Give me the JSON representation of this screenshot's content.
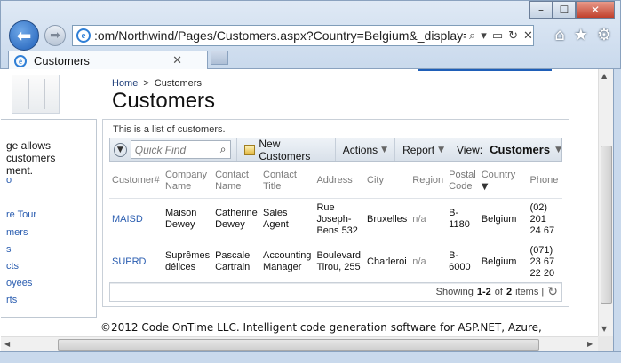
{
  "browser": {
    "address": ":om/Northwind/Pages/Customers.aspx?Country=Belgium&_display=Country",
    "tab_label": "Customers",
    "controls": {
      "minimize": "–",
      "maximize": "☐",
      "close": "✕"
    }
  },
  "sidebar": {
    "description": "ge allows customers\nment.",
    "links": [
      "o",
      "re Tour",
      "mers",
      "s",
      "cts",
      "oyees",
      "rts"
    ]
  },
  "breadcrumb": {
    "home": "Home",
    "separator": ">",
    "current": "Customers"
  },
  "page_title": "Customers",
  "panel": {
    "description": "This is a list of customers.",
    "toolbar": {
      "quick_find_placeholder": "Quick Find",
      "new_label": "New Customers",
      "actions_label": "Actions",
      "report_label": "Report",
      "view_label": "View:",
      "view_value": "Customers"
    },
    "columns": [
      "Customer#",
      "Company Name",
      "Contact Name",
      "Contact Title",
      "Address",
      "City",
      "Region",
      "Postal Code",
      "Country",
      "Phone"
    ],
    "rows": [
      {
        "id": "MAISD",
        "company": "Maison Dewey",
        "contact": "Catherine Dewey",
        "title": "Sales Agent",
        "address": "Rue Joseph-Bens 532",
        "city": "Bruxelles",
        "region": "n/a",
        "postal": "B-1180",
        "country": "Belgium",
        "phone": "(02) 201 24 67"
      },
      {
        "id": "SUPRD",
        "company": "Suprêmes délices",
        "contact": "Pascale Cartrain",
        "title": "Accounting Manager",
        "address": "Boulevard Tirou, 255",
        "city": "Charleroi",
        "region": "n/a",
        "postal": "B-6000",
        "country": "Belgium",
        "phone": "(071) 23 67 22 20"
      }
    ],
    "pager": {
      "showing": "Showing",
      "range": "1-2",
      "of": "of",
      "total": "2",
      "items": "items |"
    }
  },
  "footer": "©2012 Code OnTime LLC. Intelligent code generation software for ASP.NET, Azure,"
}
